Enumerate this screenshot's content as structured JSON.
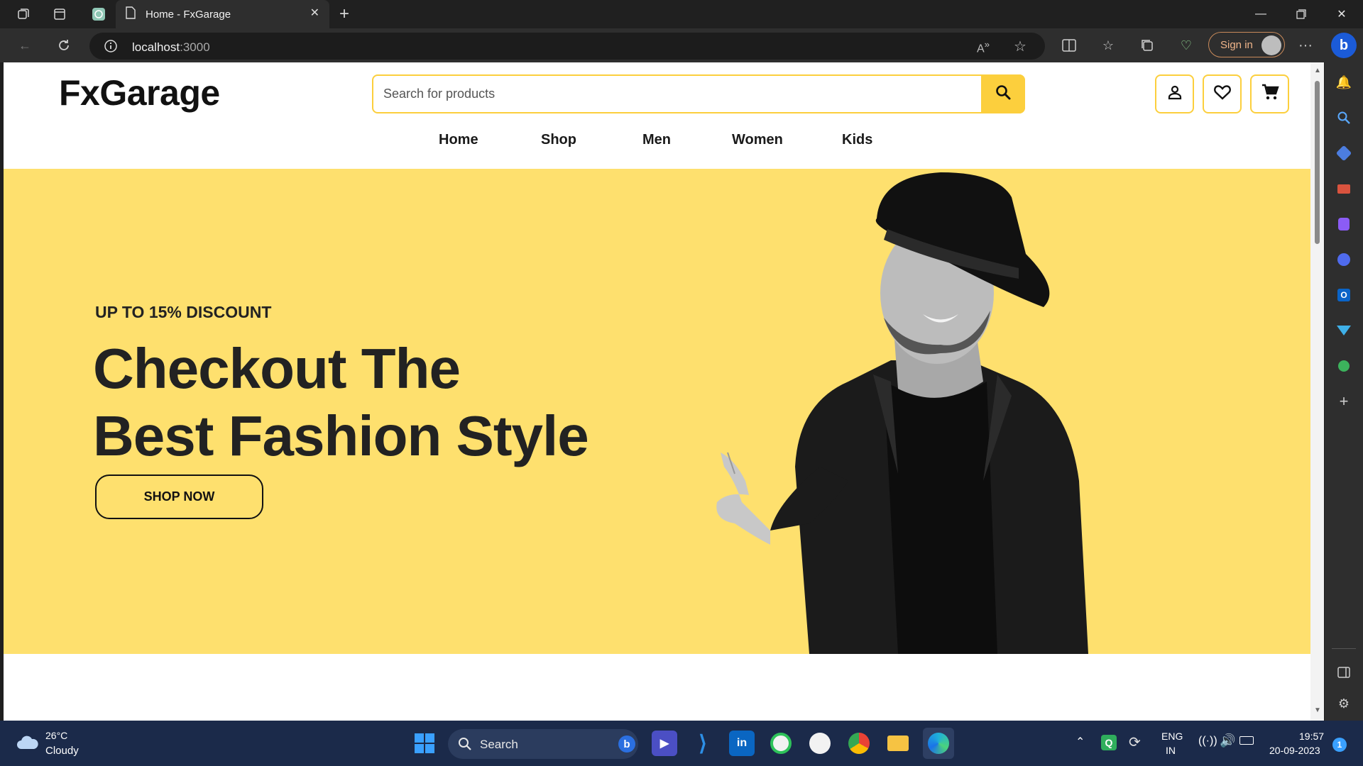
{
  "browser": {
    "tab_title": "Home - FxGarage",
    "url_host": "localhost",
    "url_port": ":3000",
    "sign_in_label": "Sign in"
  },
  "site": {
    "logo": "FxGarage",
    "search_placeholder": "Search for products",
    "menu": [
      "Home",
      "Shop",
      "Men",
      "Women",
      "Kids"
    ]
  },
  "hero": {
    "discount": "UP TO 15% DISCOUNT",
    "headline_line1": "Checkout The",
    "headline_line2": "Best Fashion Style",
    "cta": "SHOP NOW",
    "background_color": "#fee06e"
  },
  "taskbar": {
    "weather_temp": "26°C",
    "weather_condition": "Cloudy",
    "search_label": "Search",
    "lang_line1": "ENG",
    "lang_line2": "IN",
    "time": "19:57",
    "date": "20-09-2023",
    "notification_count": "1"
  },
  "icons": {
    "header": [
      "user-icon",
      "heart-icon",
      "cart-icon"
    ],
    "accent": "#fccf3d"
  }
}
